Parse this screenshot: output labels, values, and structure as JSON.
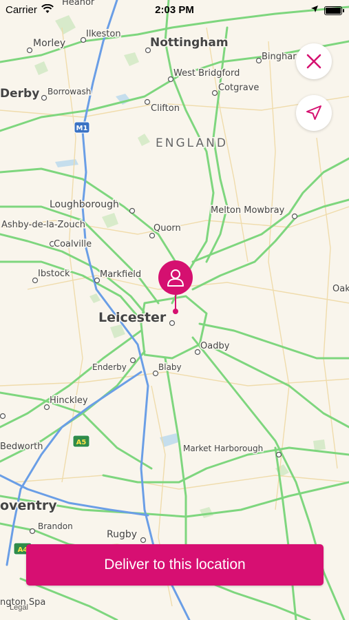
{
  "status_bar": {
    "carrier": "Carrier",
    "time": "2:03 PM"
  },
  "map": {
    "region_label": "ENGLAND",
    "legal": "Legal",
    "places": {
      "heanor": "Heanor",
      "ilkeston": "Ilkeston",
      "morley": "Morley",
      "nottingham": "Nottingham",
      "bingham": "Binghar",
      "derby": "Derby",
      "borrowash": "Borrowash",
      "west_bridgford": "West Bridgford",
      "cotgrave": "Cotgrave",
      "clifton": "Clifton",
      "loughborough": "Loughborough",
      "melton_mowbray": "Melton Mowbray",
      "ashby": "Ashby-de-la-Zouch",
      "quorn": "Quorn",
      "coalville": "Coalville",
      "ibstock": "Ibstock",
      "markfield": "Markfield",
      "oakham": "Oak",
      "leicester": "Leicester",
      "oadby": "Oadby",
      "enderby": "Enderby",
      "blaby": "Blaby",
      "hinckley": "Hinckley",
      "bedworth": "Bedworth",
      "market_harborough": "Market Harborough",
      "coventry": "oventry",
      "brandon": "Brandon",
      "rugby": "Rugby",
      "leamington": "ngton Spa"
    },
    "roads": {
      "m1": "M1",
      "a5": "A5",
      "a46": "A4"
    }
  },
  "buttons": {
    "deliver_label": "Deliver to this location"
  },
  "colors": {
    "accent": "#d51070",
    "map_background": "#f9f5ec",
    "major_road": "#7ed67e",
    "motorway": "#6a9ee6"
  },
  "icons": {
    "close": "close-icon",
    "locate": "navigation-arrow-icon",
    "pin": "user-icon"
  }
}
